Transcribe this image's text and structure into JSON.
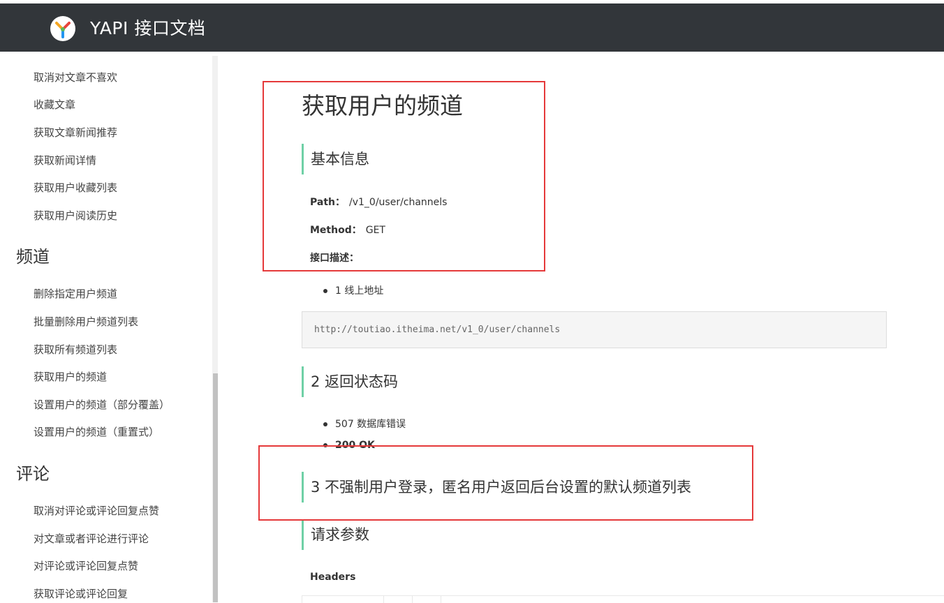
{
  "app": {
    "title": "YAPI 接口文档",
    "logo_icon": "yapi-logo-icon"
  },
  "sidebar": {
    "groups": [
      {
        "items": [
          "取消对文章不喜欢",
          "收藏文章",
          "获取文章新闻推荐",
          "获取新闻详情",
          "获取用户收藏列表",
          "获取用户阅读历史"
        ]
      },
      {
        "title": "频道",
        "items": [
          "删除指定用户频道",
          "批量删除用户频道列表",
          "获取所有频道列表",
          "获取用户的频道",
          "设置用户的频道（部分覆盖）",
          "设置用户的频道（重置式）"
        ]
      },
      {
        "title": "评论",
        "items": [
          "取消对评论或评论回复点赞",
          "对文章或者评论进行评论",
          "对评论或评论回复点赞",
          "获取评论或评论回复"
        ]
      }
    ]
  },
  "doc": {
    "title": "获取用户的频道",
    "basic_info": {
      "heading": "基本信息",
      "path_label": "Path：",
      "path_value": "/v1_0/user/channels",
      "method_label": "Method：",
      "method_value": "GET",
      "desc_label": "接口描述："
    },
    "online_bullet": "1 线上地址",
    "online_url": "http://toutiao.itheima.net/v1_0/user/channels",
    "status_heading": "2 返回状态码",
    "status_items": [
      "507 数据库错误",
      "200 OK"
    ],
    "note_heading": "3 不强制用户登录，匿名用户返回后台设置的默认频道列表",
    "params_heading": "请求参数",
    "headers_label": "Headers"
  },
  "colors": {
    "topbar": "#32363a",
    "accent": "#6fd0a6",
    "highlight": "#e5393a"
  }
}
